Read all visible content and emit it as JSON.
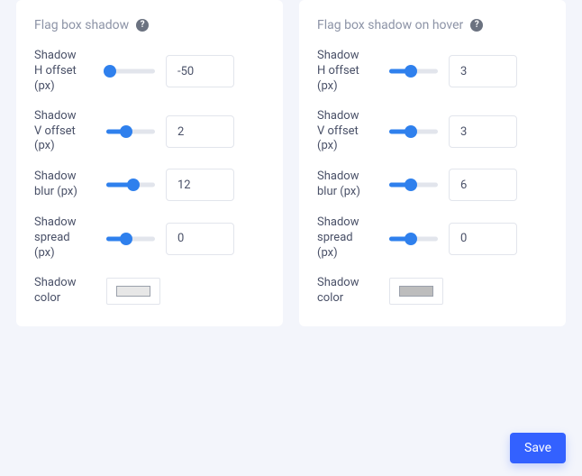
{
  "panels": [
    {
      "title": "Flag box shadow",
      "rows": [
        {
          "label": "Shadow H offset (px)",
          "value": "-50",
          "slider_pct": 8
        },
        {
          "label": "Shadow V offset (px)",
          "value": "2",
          "slider_pct": 40
        },
        {
          "label": "Shadow blur (px)",
          "value": "12",
          "slider_pct": 55
        },
        {
          "label": "Shadow spread (px)",
          "value": "0",
          "slider_pct": 40
        }
      ],
      "color_label": "Shadow color",
      "color_value": "#e7e7e7"
    },
    {
      "title": "Flag box shadow on hover",
      "rows": [
        {
          "label": "Shadow H offset (px)",
          "value": "3",
          "slider_pct": 45
        },
        {
          "label": "Shadow V offset (px)",
          "value": "3",
          "slider_pct": 45
        },
        {
          "label": "Shadow blur (px)",
          "value": "6",
          "slider_pct": 45
        },
        {
          "label": "Shadow spread (px)",
          "value": "0",
          "slider_pct": 45
        }
      ],
      "color_label": "Shadow color",
      "color_value": "#bdbdbd"
    }
  ],
  "save_label": "Save",
  "help_glyph": "?"
}
